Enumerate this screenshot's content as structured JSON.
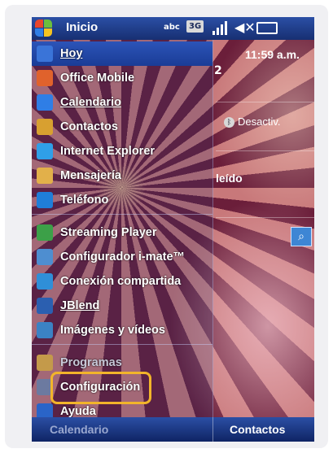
{
  "status_bar": {
    "title": "Inicio",
    "input_mode": "abc",
    "network": "3G",
    "signal_icon": "signal-icon",
    "volume_icon": "speaker-off-icon",
    "battery_icon": "battery-icon"
  },
  "today": {
    "time": "11:59 a.m.",
    "count": "2",
    "bluetooth": "Desactiv.",
    "unread": "leído"
  },
  "menu": {
    "items": [
      {
        "label": "Hoy",
        "icon": "today-icon"
      },
      {
        "label": "Office Mobile",
        "icon": "office-icon"
      },
      {
        "label": "Calendario",
        "icon": "calendar-icon"
      },
      {
        "label": "Contactos",
        "icon": "contacts-icon"
      },
      {
        "label": "Internet Explorer",
        "icon": "internet-explorer-icon"
      },
      {
        "label": "Mensajería",
        "icon": "messaging-icon"
      },
      {
        "label": "Teléfono",
        "icon": "phone-icon"
      },
      {
        "label": "Streaming Player",
        "icon": "streaming-icon"
      },
      {
        "label": "Configurador i-mate™",
        "icon": "configurator-icon"
      },
      {
        "label": "Conexión compartida",
        "icon": "sharing-icon"
      },
      {
        "label": "JBlend",
        "icon": "jblend-icon"
      },
      {
        "label": "Imágenes y vídeos",
        "icon": "pictures-icon"
      },
      {
        "label": "Programas",
        "icon": "programs-icon"
      },
      {
        "label": "Configuración",
        "icon": "settings-icon"
      },
      {
        "label": "Ayuda",
        "icon": "help-icon"
      }
    ]
  },
  "softkeys": {
    "left": "Calendario",
    "right": "Contactos"
  },
  "colors": {
    "highlight": "#f2b52a",
    "selection": "#2c54b8"
  }
}
